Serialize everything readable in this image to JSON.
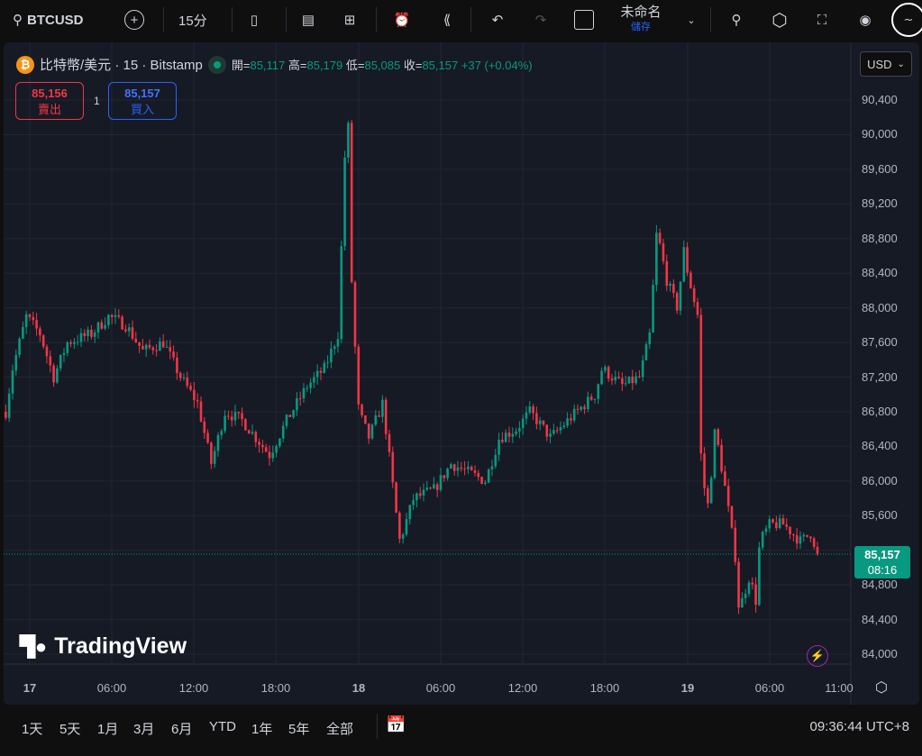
{
  "toolbar": {
    "symbol": "BTCUSD",
    "interval": "15分",
    "layout_name": "未命名",
    "save_label": "儲存",
    "icons": [
      "search-icon",
      "add-symbol-icon",
      "candles-icon",
      "indicators-icon",
      "layout-grid-icon",
      "alert-icon",
      "replay-icon",
      "undo-icon",
      "redo-icon",
      "rectangle-icon",
      "quick-search-icon",
      "settings-icon",
      "fullscreen-icon",
      "camera-icon",
      "publish-icon"
    ]
  },
  "legend": {
    "title": "比特幣/美元 · 15 · Bitstamp",
    "open_label": "開=",
    "open": "85,117",
    "high_label": "高=",
    "high": "85,179",
    "low_label": "低=",
    "low": "85,085",
    "close_label": "收=",
    "close": "85,157",
    "change": "+37 (+0.04%)"
  },
  "trade": {
    "sell_price": "85,156",
    "sell_label": "賣出",
    "spread": "1",
    "buy_price": "85,157",
    "buy_label": "買入"
  },
  "currency": "USD",
  "price_axis": [
    "90,400",
    "90,000",
    "89,600",
    "89,200",
    "88,800",
    "88,400",
    "88,000",
    "87,600",
    "87,200",
    "86,800",
    "86,400",
    "86,000",
    "85,600",
    "85,200",
    "84,800",
    "84,400",
    "84,000"
  ],
  "current_price": {
    "value": "85,157",
    "countdown": "08:16"
  },
  "time_axis": [
    "17",
    "06:00",
    "12:00",
    "18:00",
    "18",
    "06:00",
    "12:00",
    "18:00",
    "19",
    "06:00",
    "11:00"
  ],
  "watermark": "TradingView",
  "colors": {
    "up": "#089981",
    "down": "#f23645",
    "background": "#161a25"
  },
  "chart_data": {
    "type": "candlestick",
    "approx_close_path": [
      [
        "16 22:15",
        86800
      ],
      [
        "16 22:45",
        87300
      ],
      [
        "16 23:45",
        87900
      ],
      [
        "17 00:45",
        87700
      ],
      [
        "17 01:45",
        87200
      ],
      [
        "17 02:45",
        87600
      ],
      [
        "17 04:30",
        87700
      ],
      [
        "17 05:45",
        87900
      ],
      [
        "17 07:00",
        87800
      ],
      [
        "17 08:15",
        87500
      ],
      [
        "17 09:45",
        87600
      ],
      [
        "17 11:00",
        87200
      ],
      [
        "17 12:15",
        86900
      ],
      [
        "17 13:15",
        86200
      ],
      [
        "17 14:15",
        86800
      ],
      [
        "17 15:30",
        86700
      ],
      [
        "17 17:00",
        86400
      ],
      [
        "17 17:30",
        86300
      ],
      [
        "17 18:45",
        86700
      ],
      [
        "17 20:15",
        87100
      ],
      [
        "17 21:30",
        87300
      ],
      [
        "17 22:30",
        87700
      ],
      [
        "17 23:00",
        89800
      ],
      [
        "17 23:15",
        90100
      ],
      [
        "17 23:30",
        88200
      ],
      [
        "18 00:00",
        86800
      ],
      [
        "18 00:45",
        86500
      ],
      [
        "18 01:45",
        86900
      ],
      [
        "18 02:45",
        85600
      ],
      [
        "18 03:00",
        85300
      ],
      [
        "18 04:00",
        85800
      ],
      [
        "18 05:30",
        85900
      ],
      [
        "18 06:45",
        86200
      ],
      [
        "18 08:00",
        86100
      ],
      [
        "18 09:15",
        86000
      ],
      [
        "18 10:15",
        86500
      ],
      [
        "18 11:30",
        86600
      ],
      [
        "18 12:30",
        86800
      ],
      [
        "18 14:00",
        86500
      ],
      [
        "18 15:15",
        86700
      ],
      [
        "18 17:15",
        87000
      ],
      [
        "18 17:45",
        87300
      ],
      [
        "18 19:15",
        87100
      ],
      [
        "18 20:30",
        87200
      ],
      [
        "18 21:15",
        87700
      ],
      [
        "18 21:45",
        88900
      ],
      [
        "18 22:30",
        88300
      ],
      [
        "18 23:15",
        88000
      ],
      [
        "18 23:45",
        88700
      ],
      [
        "19 00:00",
        88400
      ],
      [
        "19 00:45",
        87900
      ],
      [
        "19 01:00",
        86100
      ],
      [
        "19 01:30",
        85700
      ],
      [
        "19 02:00",
        86600
      ],
      [
        "19 02:45",
        85900
      ],
      [
        "19 03:30",
        85100
      ],
      [
        "19 03:45",
        84500
      ],
      [
        "19 04:30",
        84900
      ],
      [
        "19 05:00",
        84600
      ],
      [
        "19 05:15",
        85300
      ],
      [
        "19 06:00",
        85500
      ],
      [
        "19 07:00",
        85500
      ],
      [
        "19 08:15",
        85300
      ],
      [
        "19 09:00",
        85400
      ],
      [
        "19 09:30",
        85157
      ]
    ],
    "ylim": [
      84000,
      90400
    ]
  },
  "bottom": {
    "ranges": [
      "1天",
      "5天",
      "1月",
      "3月",
      "6月",
      "YTD",
      "1年",
      "5年",
      "全部"
    ],
    "clock": "09:36:44 UTC+8"
  }
}
